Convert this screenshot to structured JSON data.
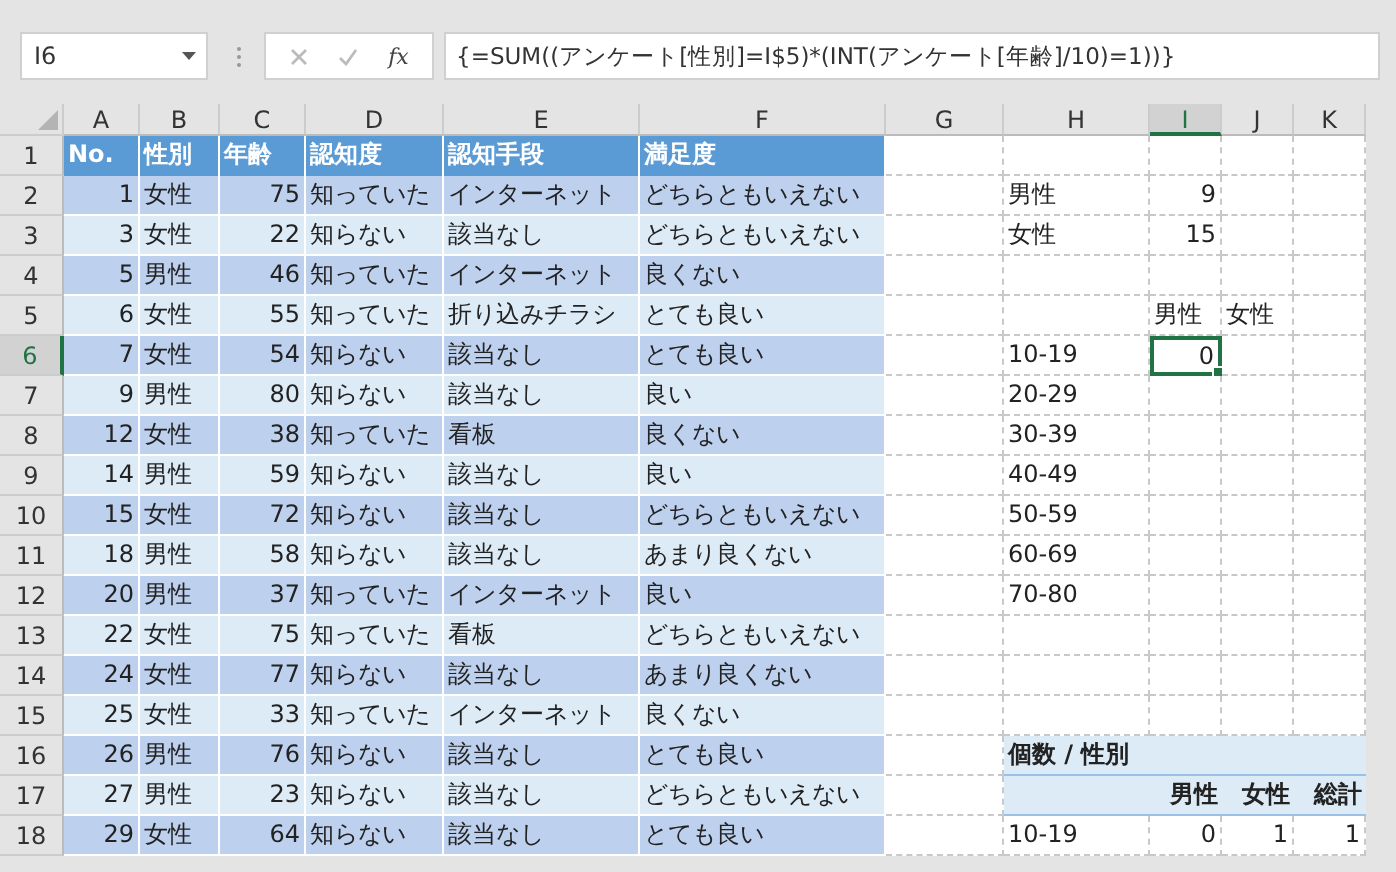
{
  "formula_bar": {
    "name_box": "I6",
    "function_label": "fx",
    "formula": "{=SUM((アンケート[性別]=I$5)*(INT(アンケート[年齢]/10)=1))}"
  },
  "columns": [
    {
      "letter": "A",
      "kind": "list",
      "selected": false
    },
    {
      "letter": "B",
      "kind": "list",
      "selected": false
    },
    {
      "letter": "C",
      "kind": "list",
      "selected": false
    },
    {
      "letter": "D",
      "kind": "list",
      "selected": false
    },
    {
      "letter": "E",
      "kind": "list",
      "selected": false
    },
    {
      "letter": "F",
      "kind": "list",
      "selected": false
    },
    {
      "letter": "G",
      "kind": "plain",
      "selected": false
    },
    {
      "letter": "H",
      "kind": "pivot",
      "selected": false
    },
    {
      "letter": "I",
      "kind": "pivot",
      "selected": true
    },
    {
      "letter": "J",
      "kind": "pivot",
      "selected": false
    },
    {
      "letter": "K",
      "kind": "pivot",
      "selected": false
    }
  ],
  "rows": [
    {
      "number": "1",
      "selected": false,
      "kind": "header",
      "cells": {
        "A": {
          "text": "No."
        },
        "B": {
          "text": "性別"
        },
        "C": {
          "text": "年齢"
        },
        "D": {
          "text": "認知度"
        },
        "E": {
          "text": "認知手段"
        },
        "F": {
          "text": "満足度"
        }
      }
    },
    {
      "number": "2",
      "selected": false,
      "kind": "record",
      "cells": {
        "A": {
          "text": "1",
          "kind": "number"
        },
        "B": {
          "text": "女性"
        },
        "C": {
          "text": "75",
          "kind": "number"
        },
        "D": {
          "text": "知っていた"
        },
        "E": {
          "text": "インターネット"
        },
        "F": {
          "text": "どちらともいえない"
        },
        "H": {
          "text": "男性"
        },
        "I": {
          "text": "9",
          "kind": "number"
        }
      }
    },
    {
      "number": "3",
      "selected": false,
      "kind": "record",
      "cells": {
        "A": {
          "text": "3",
          "kind": "number"
        },
        "B": {
          "text": "女性"
        },
        "C": {
          "text": "22",
          "kind": "number"
        },
        "D": {
          "text": "知らない"
        },
        "E": {
          "text": "該当なし"
        },
        "F": {
          "text": "どちらともいえない"
        },
        "H": {
          "text": "女性"
        },
        "I": {
          "text": "15",
          "kind": "number"
        }
      }
    },
    {
      "number": "4",
      "selected": false,
      "kind": "record",
      "cells": {
        "A": {
          "text": "5",
          "kind": "number"
        },
        "B": {
          "text": "男性"
        },
        "C": {
          "text": "46",
          "kind": "number"
        },
        "D": {
          "text": "知っていた"
        },
        "E": {
          "text": "インターネット"
        },
        "F": {
          "text": "良くない"
        }
      }
    },
    {
      "number": "5",
      "selected": false,
      "kind": "record",
      "cells": {
        "A": {
          "text": "6",
          "kind": "number"
        },
        "B": {
          "text": "女性"
        },
        "C": {
          "text": "55",
          "kind": "number"
        },
        "D": {
          "text": "知っていた"
        },
        "E": {
          "text": "折り込みチラシ"
        },
        "F": {
          "text": "とても良い"
        },
        "I": {
          "text": "男性"
        },
        "J": {
          "text": "女性"
        }
      }
    },
    {
      "number": "6",
      "selected": true,
      "kind": "record",
      "cells": {
        "A": {
          "text": "7",
          "kind": "number"
        },
        "B": {
          "text": "女性"
        },
        "C": {
          "text": "54",
          "kind": "number"
        },
        "D": {
          "text": "知らない"
        },
        "E": {
          "text": "該当なし"
        },
        "F": {
          "text": "とても良い"
        },
        "H": {
          "text": "10-19"
        },
        "I": {
          "text": "0",
          "kind": "number"
        }
      }
    },
    {
      "number": "7",
      "selected": false,
      "kind": "record",
      "cells": {
        "A": {
          "text": "9",
          "kind": "number"
        },
        "B": {
          "text": "男性"
        },
        "C": {
          "text": "80",
          "kind": "number"
        },
        "D": {
          "text": "知らない"
        },
        "E": {
          "text": "該当なし"
        },
        "F": {
          "text": "良い"
        },
        "H": {
          "text": "20-29"
        }
      }
    },
    {
      "number": "8",
      "selected": false,
      "kind": "record",
      "cells": {
        "A": {
          "text": "12",
          "kind": "number"
        },
        "B": {
          "text": "女性"
        },
        "C": {
          "text": "38",
          "kind": "number"
        },
        "D": {
          "text": "知っていた"
        },
        "E": {
          "text": "看板"
        },
        "F": {
          "text": "良くない"
        },
        "H": {
          "text": "30-39"
        }
      }
    },
    {
      "number": "9",
      "selected": false,
      "kind": "record",
      "cells": {
        "A": {
          "text": "14",
          "kind": "number"
        },
        "B": {
          "text": "男性"
        },
        "C": {
          "text": "59",
          "kind": "number"
        },
        "D": {
          "text": "知らない"
        },
        "E": {
          "text": "該当なし"
        },
        "F": {
          "text": "良い"
        },
        "H": {
          "text": "40-49"
        }
      }
    },
    {
      "number": "10",
      "selected": false,
      "kind": "record",
      "cells": {
        "A": {
          "text": "15",
          "kind": "number"
        },
        "B": {
          "text": "女性"
        },
        "C": {
          "text": "72",
          "kind": "number"
        },
        "D": {
          "text": "知らない"
        },
        "E": {
          "text": "該当なし"
        },
        "F": {
          "text": "どちらともいえない"
        },
        "H": {
          "text": "50-59"
        }
      }
    },
    {
      "number": "11",
      "selected": false,
      "kind": "record",
      "cells": {
        "A": {
          "text": "18",
          "kind": "number"
        },
        "B": {
          "text": "男性"
        },
        "C": {
          "text": "58",
          "kind": "number"
        },
        "D": {
          "text": "知らない"
        },
        "E": {
          "text": "該当なし"
        },
        "F": {
          "text": "あまり良くない"
        },
        "H": {
          "text": "60-69"
        }
      }
    },
    {
      "number": "12",
      "selected": false,
      "kind": "record",
      "cells": {
        "A": {
          "text": "20",
          "kind": "number"
        },
        "B": {
          "text": "男性"
        },
        "C": {
          "text": "37",
          "kind": "number"
        },
        "D": {
          "text": "知っていた"
        },
        "E": {
          "text": "インターネット"
        },
        "F": {
          "text": "良い"
        },
        "H": {
          "text": "70-80"
        }
      }
    },
    {
      "number": "13",
      "selected": false,
      "kind": "record",
      "cells": {
        "A": {
          "text": "22",
          "kind": "number"
        },
        "B": {
          "text": "女性"
        },
        "C": {
          "text": "75",
          "kind": "number"
        },
        "D": {
          "text": "知っていた"
        },
        "E": {
          "text": "看板"
        },
        "F": {
          "text": "どちらともいえない"
        }
      }
    },
    {
      "number": "14",
      "selected": false,
      "kind": "record",
      "cells": {
        "A": {
          "text": "24",
          "kind": "number"
        },
        "B": {
          "text": "女性"
        },
        "C": {
          "text": "77",
          "kind": "number"
        },
        "D": {
          "text": "知らない"
        },
        "E": {
          "text": "該当なし"
        },
        "F": {
          "text": "あまり良くない"
        }
      }
    },
    {
      "number": "15",
      "selected": false,
      "kind": "record",
      "cells": {
        "A": {
          "text": "25",
          "kind": "number"
        },
        "B": {
          "text": "女性"
        },
        "C": {
          "text": "33",
          "kind": "number"
        },
        "D": {
          "text": "知っていた"
        },
        "E": {
          "text": "インターネット"
        },
        "F": {
          "text": "良くない"
        }
      }
    },
    {
      "number": "16",
      "selected": false,
      "kind": "record",
      "pivot_header": true,
      "cells": {
        "A": {
          "text": "26",
          "kind": "number"
        },
        "B": {
          "text": "男性"
        },
        "C": {
          "text": "76",
          "kind": "number"
        },
        "D": {
          "text": "知らない"
        },
        "E": {
          "text": "該当なし"
        },
        "F": {
          "text": "とても良い"
        },
        "H": {
          "text": "個数 / 性別"
        }
      }
    },
    {
      "number": "17",
      "selected": false,
      "kind": "record",
      "pivot_header": true,
      "cells": {
        "A": {
          "text": "27",
          "kind": "number"
        },
        "B": {
          "text": "男性"
        },
        "C": {
          "text": "23",
          "kind": "number"
        },
        "D": {
          "text": "知らない"
        },
        "E": {
          "text": "該当なし"
        },
        "F": {
          "text": "どちらともいえない"
        },
        "I": {
          "text": "男性",
          "kind": "number"
        },
        "J": {
          "text": "女性",
          "kind": "number"
        },
        "K": {
          "text": "総計",
          "kind": "number"
        }
      }
    },
    {
      "number": "18",
      "selected": false,
      "kind": "record",
      "cells": {
        "A": {
          "text": "29",
          "kind": "number"
        },
        "B": {
          "text": "女性"
        },
        "C": {
          "text": "64",
          "kind": "number"
        },
        "D": {
          "text": "知らない"
        },
        "E": {
          "text": "該当なし"
        },
        "F": {
          "text": "とても良い"
        },
        "H": {
          "text": "10-19"
        },
        "I": {
          "text": "0",
          "kind": "number"
        },
        "J": {
          "text": "1",
          "kind": "number"
        },
        "K": {
          "text": "1",
          "kind": "number"
        }
      }
    }
  ]
}
